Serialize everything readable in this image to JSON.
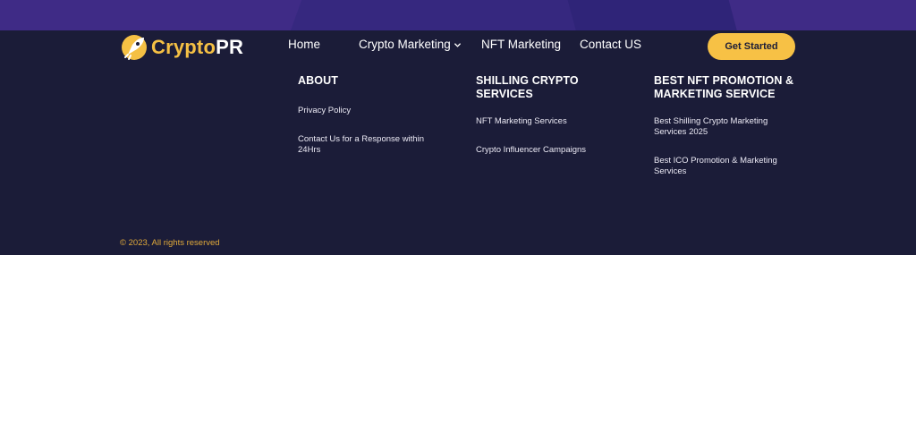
{
  "brand": {
    "logo_part1": "Crypto",
    "logo_part2": "PR"
  },
  "nav": {
    "home": "Home",
    "crypto_marketing": "Crypto Marketing",
    "nft_marketing": "NFT Marketing",
    "contact": "Contact US"
  },
  "cta": {
    "label": "Get Started"
  },
  "columns": {
    "about": {
      "heading": "ABOUT",
      "links": [
        "Privacy Policy",
        "Contact Us for a Response within 24Hrs"
      ]
    },
    "shilling": {
      "heading": "SHILLING CRYPTO SERVICES",
      "links": [
        "NFT Marketing Services",
        "Crypto Influencer Campaigns"
      ]
    },
    "nft": {
      "heading": "BEST NFT PROMOTION & MARKETING SERVICE",
      "links": [
        "Best Shilling Crypto Marketing Services 2025",
        "Best ICO Promotion & Marketing Services"
      ]
    }
  },
  "footer": {
    "copyright": "© 2023, All rights reserved"
  },
  "colors": {
    "footer_bg": "#1b1c38",
    "top_band": "#3f2b86",
    "accent": "#f7c145",
    "copyright": "#e0a93a"
  },
  "icons": {
    "logo": "rocket-icon",
    "dropdown": "chevron-down-icon"
  }
}
